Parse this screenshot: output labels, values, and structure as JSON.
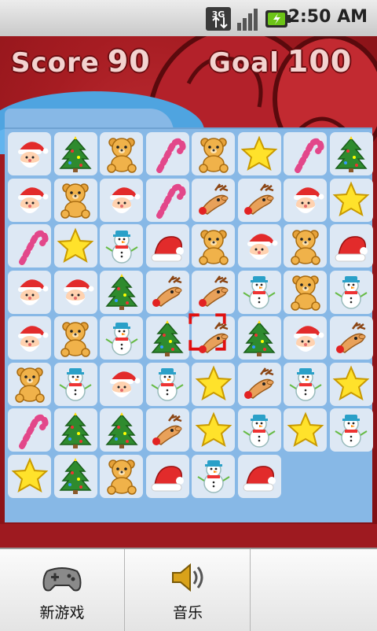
{
  "status_bar": {
    "network_type": "3G",
    "time": "2:50 AM",
    "icons": [
      "3g-data-icon",
      "signal-strength-icon",
      "battery-charging-icon"
    ]
  },
  "hud": {
    "score_label": "Score",
    "score_value": "90",
    "goal_label": "Goal",
    "goal_value": "100"
  },
  "board": {
    "rows": 8,
    "cols": 8,
    "selected": {
      "row": 4,
      "col": 4
    },
    "grid": [
      [
        "santa",
        "tree",
        "bear",
        "cane",
        "bear",
        "star",
        "cane",
        "tree"
      ],
      [
        "santa",
        "bear",
        "santa",
        "cane",
        "reindeer",
        "reindeer",
        "santa",
        "star"
      ],
      [
        "cane",
        "star",
        "snowman",
        "hat",
        "bear",
        "santa",
        "bear",
        "hat"
      ],
      [
        "santa",
        "santa",
        "tree",
        "reindeer",
        "reindeer",
        "snowman",
        "bear",
        "snowman"
      ],
      [
        "santa",
        "bear",
        "snowman",
        "tree",
        "reindeer",
        "tree",
        "santa",
        "reindeer"
      ],
      [
        "bear",
        "snowman",
        "santa",
        "snowman",
        "star",
        "reindeer",
        "snowman",
        "star"
      ],
      [
        "cane",
        "tree",
        "tree",
        "reindeer",
        "star",
        "snowman",
        "star",
        "snowman"
      ],
      [
        "star",
        "tree",
        "bear",
        "hat",
        "snowman",
        "hat",
        "",
        ""
      ]
    ]
  },
  "menu": {
    "items": [
      {
        "label": "新游戏",
        "icon": "gamepad-icon"
      },
      {
        "label": "音乐",
        "icon": "speaker-icon"
      }
    ]
  }
}
